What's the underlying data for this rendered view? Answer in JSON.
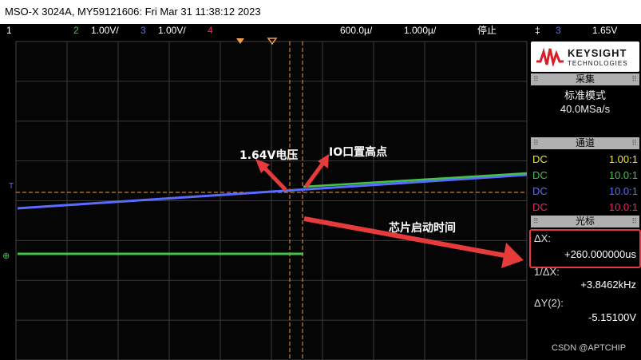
{
  "title_bar": {
    "text": "MSO-X 3024A, MY59121606: Fri Mar 31 11:38:12 2023"
  },
  "status": {
    "ch1_num": "1",
    "ch2_num": "2",
    "ch2_scale": "1.00V/",
    "ch3_num": "3",
    "ch3_scale": "1.00V/",
    "ch4_num": "4",
    "time_scale": "600.0µ/",
    "time_offset": "1.000µ/",
    "run_state": "停止",
    "trig_icon": "‡",
    "trig_ch": "3",
    "trig_level": "1.65V"
  },
  "annotations": {
    "voltage": "1.64V电压",
    "io_high": "IO口置高点",
    "startup": "芯片启动时间"
  },
  "panel": {
    "brand": "KEYSIGHT",
    "brand_sub": "TECHNOLOGIES",
    "acq_header": "采集",
    "acq_mode": "标准模式",
    "acq_rate": "40.0MSa/s",
    "ch_header": "通道",
    "channels": [
      {
        "coupling": "DC",
        "ratio": "1.00:1",
        "color": "#e8e23a"
      },
      {
        "coupling": "DC",
        "ratio": "10.0:1",
        "color": "#44c24a"
      },
      {
        "coupling": "DC",
        "ratio": "10.0:1",
        "color": "#5a6cff"
      },
      {
        "coupling": "DC",
        "ratio": "10.0:1",
        "color": "#e8286a"
      }
    ],
    "cursor_header": "光标",
    "dx_label": "ΔX:",
    "dx_value": "+260.000000us",
    "inv_dx_label": "1/ΔX:",
    "inv_dx_value": "+3.8462kHz",
    "dy_label": "ΔY(2):",
    "dy_value": "-5.15100V",
    "watermark": "CSDN @APTCHIP"
  },
  "colors": {
    "ch1": "#e8e23a",
    "ch2": "#44c24a",
    "ch3": "#5a6cff",
    "ch4": "#e8286a",
    "annotation": "#e53b3b",
    "cursor": "#f0a050"
  }
}
